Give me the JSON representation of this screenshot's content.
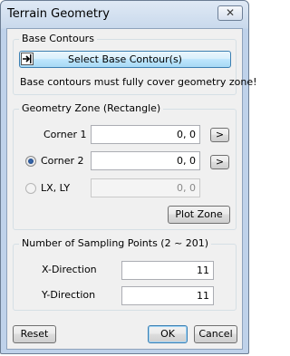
{
  "window": {
    "title": "Terrain Geometry",
    "close_glyph": "✕"
  },
  "base_contours": {
    "group_title": "Base Contours",
    "select_button_label": "Select Base Contour(s)",
    "note": "Base contours must fully cover geometry zone!"
  },
  "geometry_zone": {
    "group_title": "Geometry Zone (Rectangle)",
    "corner1_label": "Corner 1",
    "corner1_value": "0, 0",
    "corner2_label": "Corner 2",
    "corner2_value": "0, 0",
    "corner2_selected": true,
    "lxly_label": "LX, LY",
    "lxly_value": "0, 0",
    "pick_button_label": ">",
    "plot_zone_label": "Plot Zone"
  },
  "sampling": {
    "group_title": "Number of Sampling Points (2 ~ 201)",
    "x_label": "X-Direction",
    "x_value": "11",
    "y_label": "Y-Direction",
    "y_value": "11"
  },
  "footer": {
    "reset_label": "Reset",
    "ok_label": "OK",
    "cancel_label": "Cancel"
  }
}
